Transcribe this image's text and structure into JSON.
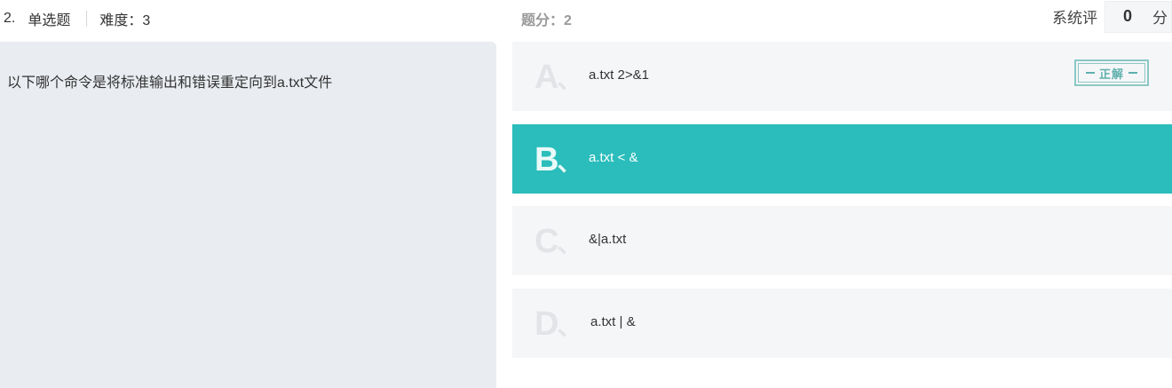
{
  "header": {
    "question_number": "2.",
    "question_type": "单选题",
    "difficulty": "难度：3",
    "points": "题分：2",
    "system_eval_label": "系统评",
    "system_eval_score": "0",
    "system_eval_unit": "分"
  },
  "question": {
    "text": "以下哪个命令是将标准输出和错误重定向到a.txt文件"
  },
  "options": [
    {
      "letter": "A",
      "sep": "、",
      "text": "a.txt 2>&1",
      "selected": false,
      "correct": true
    },
    {
      "letter": "B",
      "sep": "、",
      "text": "a.txt < &",
      "selected": true,
      "correct": false
    },
    {
      "letter": "C",
      "sep": "、",
      "text": "&|a.txt",
      "selected": false,
      "correct": false
    },
    {
      "letter": "D",
      "sep": "、",
      "text": "a.txt | &",
      "selected": false,
      "correct": false
    }
  ],
  "correct_stamp": "正解",
  "colors": {
    "selected_bg": "#2abdbb",
    "option_bg": "#f5f6f8",
    "question_bg": "#e9ecf1",
    "stamp": "#5fb0ad"
  }
}
